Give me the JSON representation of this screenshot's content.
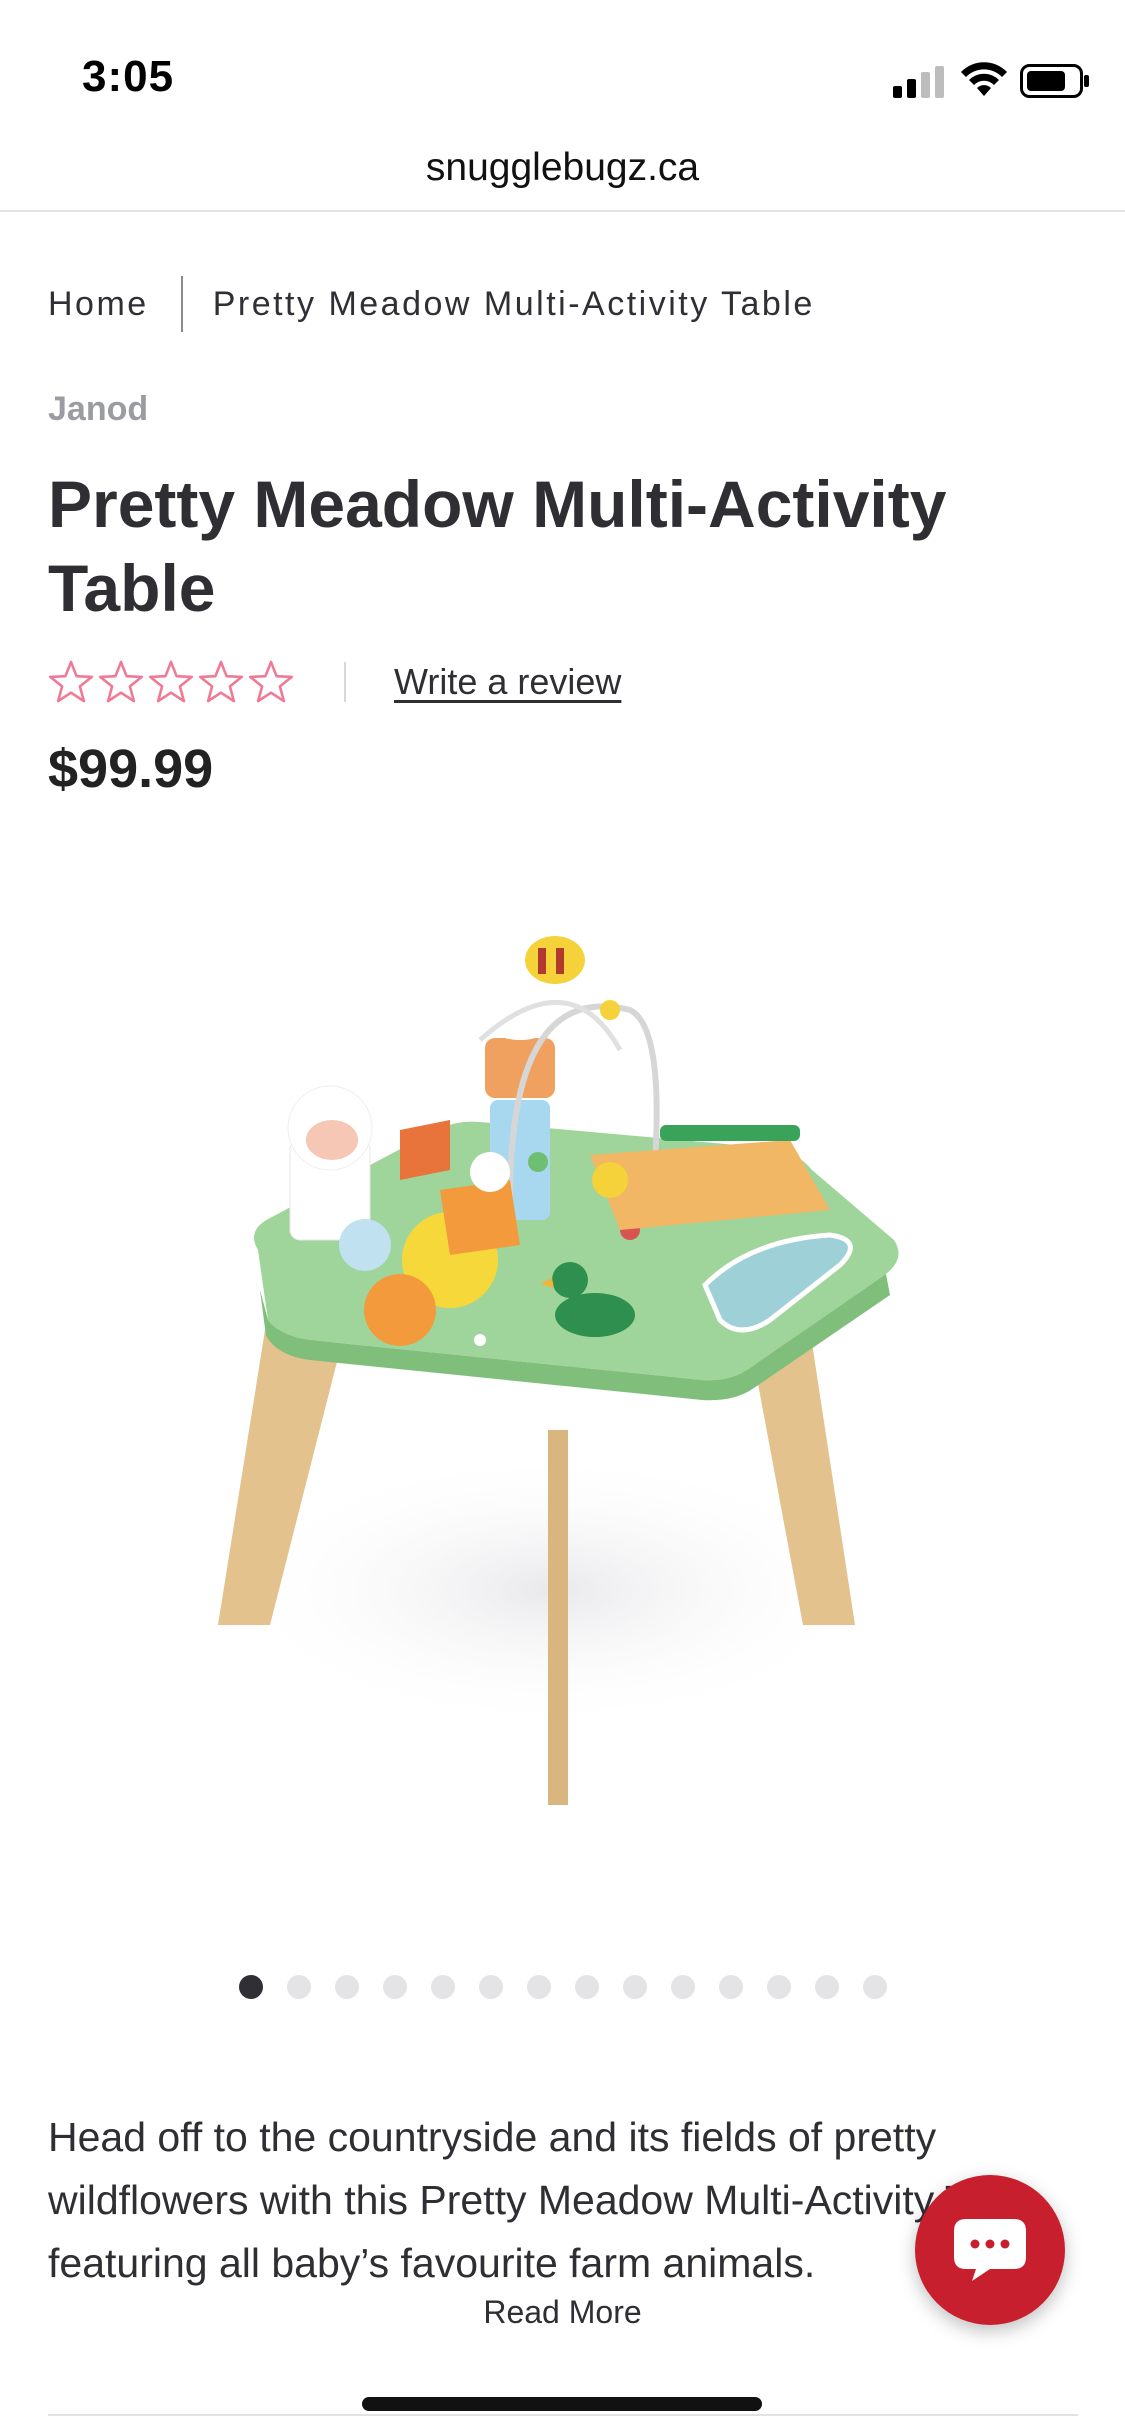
{
  "status_bar": {
    "time": "3:05"
  },
  "browser": {
    "url": "snugglebugz.ca"
  },
  "breadcrumb": {
    "home": "Home",
    "current": "Pretty Meadow Multi-Activity Table"
  },
  "product": {
    "brand": "Janod",
    "title": "Pretty Meadow Multi-Activity Table",
    "rating": {
      "stars_filled": 0,
      "stars_total": 5,
      "color": "#f07a96"
    },
    "write_review": "Write a review",
    "price": "$99.99",
    "image_icon": "activity-table-image",
    "carousel": {
      "total": 14,
      "active_index": 0
    },
    "description": "Head off to the countryside and its fields of pretty wildflowers with this Pretty Meadow Multi-Activity Table, featuring all baby’s favourite farm animals.",
    "read_more": "Read More"
  },
  "chat": {
    "icon": "chat-bubble-icon",
    "color": "#c71f2d"
  }
}
